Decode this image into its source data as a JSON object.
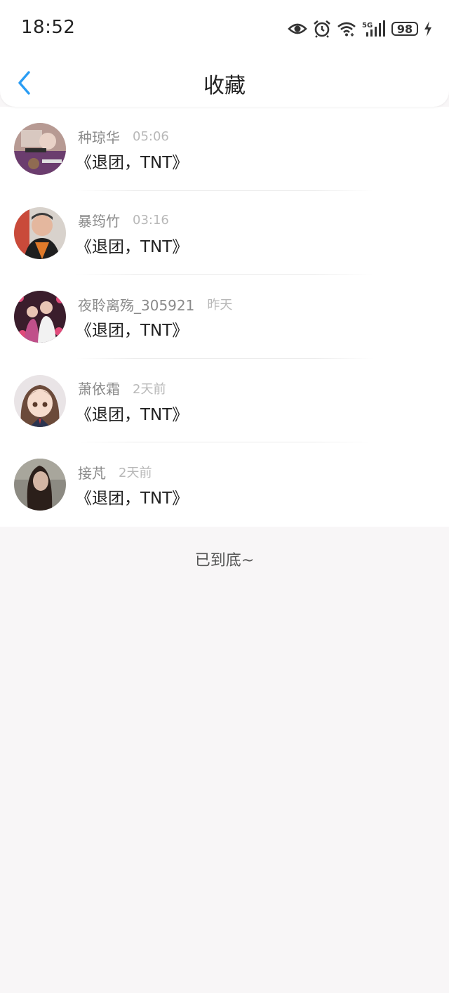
{
  "status_bar": {
    "time": "18:52",
    "network": "5G",
    "battery": "98",
    "icons": [
      "eye-icon",
      "alarm-icon",
      "wifi-icon",
      "5g-signal-icon",
      "battery-icon",
      "charging-icon"
    ]
  },
  "header": {
    "back_icon": "chevron-left-icon",
    "title": "收藏"
  },
  "favorites": [
    {
      "name": "种琼华",
      "time": "05:06",
      "title": "《退团，TNT》"
    },
    {
      "name": "暴筠竹",
      "time": "03:16",
      "title": "《退团，TNT》"
    },
    {
      "name": "夜聆离殇_305921",
      "time": "昨天",
      "title": "《退团，TNT》"
    },
    {
      "name": "萧依霜",
      "time": "2天前",
      "title": "《退团，TNT》"
    },
    {
      "name": "接芃",
      "time": "2天前",
      "title": "《退团，TNT》"
    }
  ],
  "footer": {
    "end_text": "已到底~"
  },
  "colors": {
    "accent": "#2a9df4",
    "background": "#f8f6f7",
    "name_text": "#8a8a8a",
    "time_text": "#b8b8b8"
  }
}
